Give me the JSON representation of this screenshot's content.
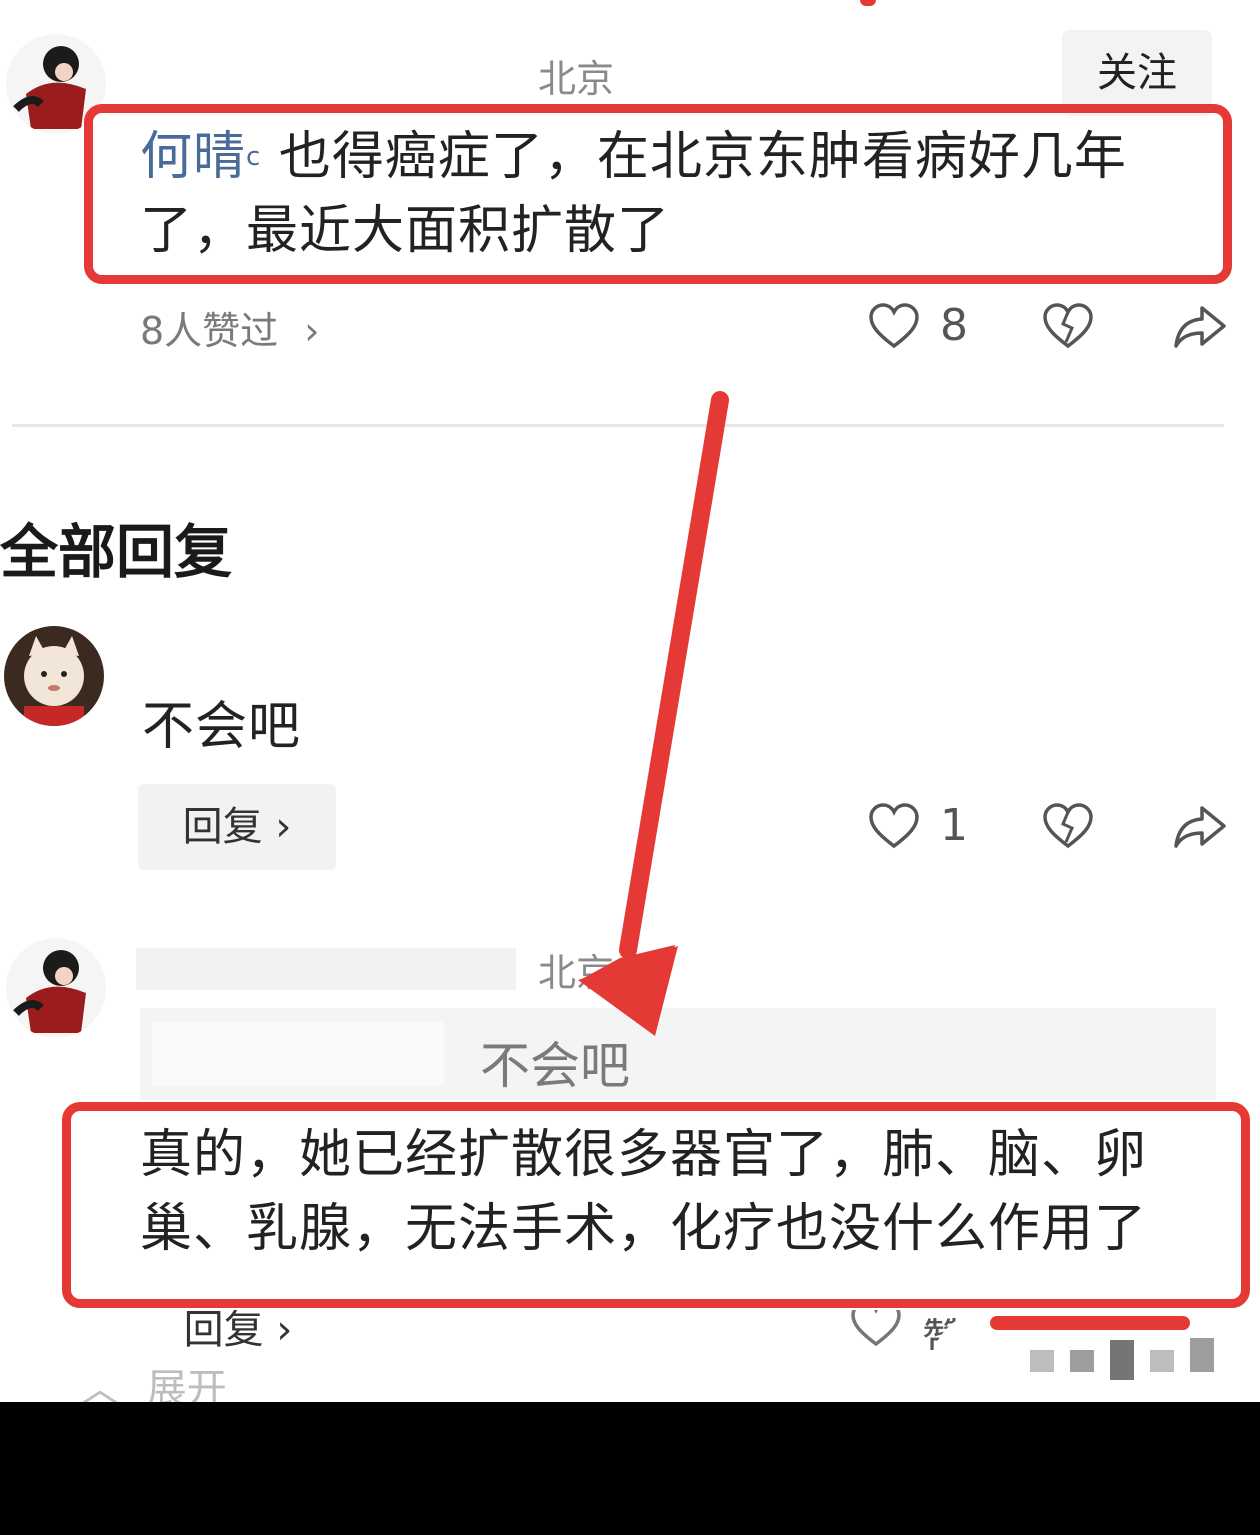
{
  "comment": {
    "location": "北京",
    "follow_label": "关注",
    "mention": "何晴",
    "text": "也得癌症了，在北京东肿看病好几年了，最近大面积扩散了",
    "likes_summary": "8人赞过",
    "like_count": "8"
  },
  "replies_section": {
    "title": "全部回复"
  },
  "reply1": {
    "text": "不会吧",
    "reply_label": "回复",
    "like_count": "1"
  },
  "reply2": {
    "location": "北京",
    "quoted_text": "不会吧",
    "text": "真的，她已经扩散很多器官了，肺、脑、卵巢、乳腺，无法手术，化疗也没什么作用了",
    "reply_label": "回复",
    "like_label": "赞"
  },
  "expand": {
    "label": "展开"
  },
  "colors": {
    "highlight": "#e53935",
    "mention": "#4a6a9a"
  },
  "icons": [
    "magnifier-icon",
    "chevron-right-icon",
    "heart-icon",
    "broken-heart-icon",
    "share-icon",
    "chevron-up-icon"
  ]
}
